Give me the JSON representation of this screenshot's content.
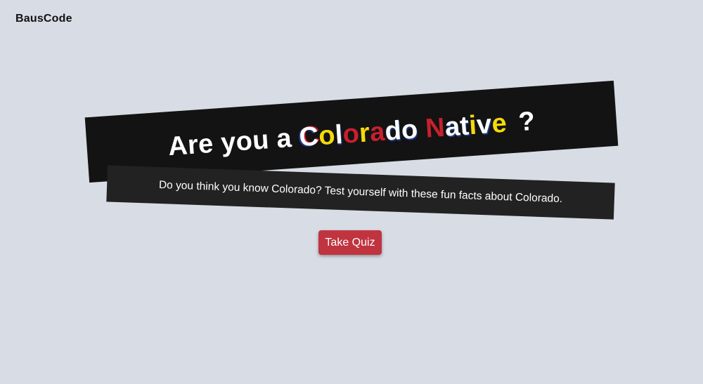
{
  "header": {
    "brand": "BausCode"
  },
  "hero": {
    "title_prefix": "Are you a",
    "title_highlight": "Colorado Native",
    "title_suffix": "?",
    "subtitle": "Do you think you know Colorado? Test yourself with these fun facts about Colorado.",
    "button_label": "Take Quiz"
  },
  "colors": {
    "background": "#d8dde5",
    "banner_dark": "#131313",
    "banner_sub": "#222222",
    "button": "#c0343f",
    "flag_red": "#c8202e",
    "flag_yellow": "#f5d90a",
    "flag_blue": "#1d3a8a"
  }
}
